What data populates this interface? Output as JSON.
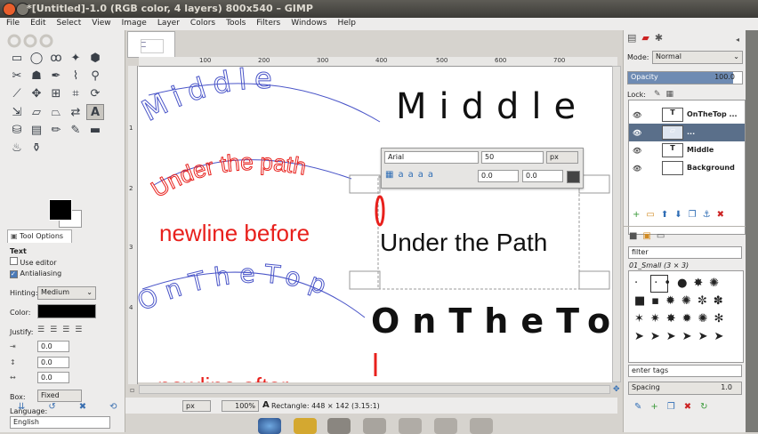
{
  "window": {
    "title": "*[Untitled]-1.0 (RGB color, 4 layers) 800x540 – GIMP"
  },
  "menu": [
    "File",
    "Edit",
    "Select",
    "View",
    "Image",
    "Layer",
    "Colors",
    "Tools",
    "Filters",
    "Windows",
    "Help"
  ],
  "tool_options": {
    "tab_label": "Tool Options",
    "section": "Text",
    "use_editor": "Use editor",
    "antialiasing": "Antialiasing",
    "hinting_label": "Hinting:",
    "hinting_value": "Medium",
    "color_label": "Color:",
    "justify_label": "Justify:",
    "indent_value": "0.0",
    "line_spacing_value": "0.0",
    "letter_spacing_value": "0.0",
    "box_label": "Box:",
    "box_value": "Fixed",
    "language_label": "Language:",
    "language_value": "English"
  },
  "ruler": {
    "top_labels": [
      "100",
      "200",
      "300",
      "400",
      "500",
      "600",
      "700"
    ],
    "left_labels": [
      "1",
      "2",
      "3",
      "4"
    ]
  },
  "text_toolbox": {
    "font": "Arial",
    "size": "50",
    "unit": "px",
    "baseline": "0.0",
    "kerning": "0.0"
  },
  "canvas_text": {
    "middle_arc": "Middle",
    "middle": "Middle",
    "under_arc": "Under the path",
    "newline_before": "newline before",
    "under_straight": "Under the Path",
    "onthetop_arc": "OnTheTop",
    "onthetop": "OnTheTop",
    "newline_after": "newline after"
  },
  "status": {
    "unit": "px",
    "zoom": "100%",
    "message": "Rectangle: 448 × 142  (3.15:1)"
  },
  "layers_panel": {
    "mode_label": "Mode:",
    "mode_value": "Normal",
    "opacity_label": "Opacity",
    "opacity_value": "100.0",
    "lock_label": "Lock:",
    "layers": [
      {
        "name": "OnTheTop ..."
      },
      {
        "name": "..."
      },
      {
        "name": "Middle"
      },
      {
        "name": "Background"
      }
    ]
  },
  "brushes_panel": {
    "filter_placeholder": "filter",
    "brush_name": "01_Small (3 × 3)",
    "tags_placeholder": "enter tags",
    "spacing_label": "Spacing",
    "spacing_value": "1.0"
  },
  "colors": {
    "fg": "#000000",
    "bg": "#ffffff",
    "blue_text": "#4a55c8",
    "red_text": "#e8201c",
    "selected_layer": "#5a6f8a"
  }
}
